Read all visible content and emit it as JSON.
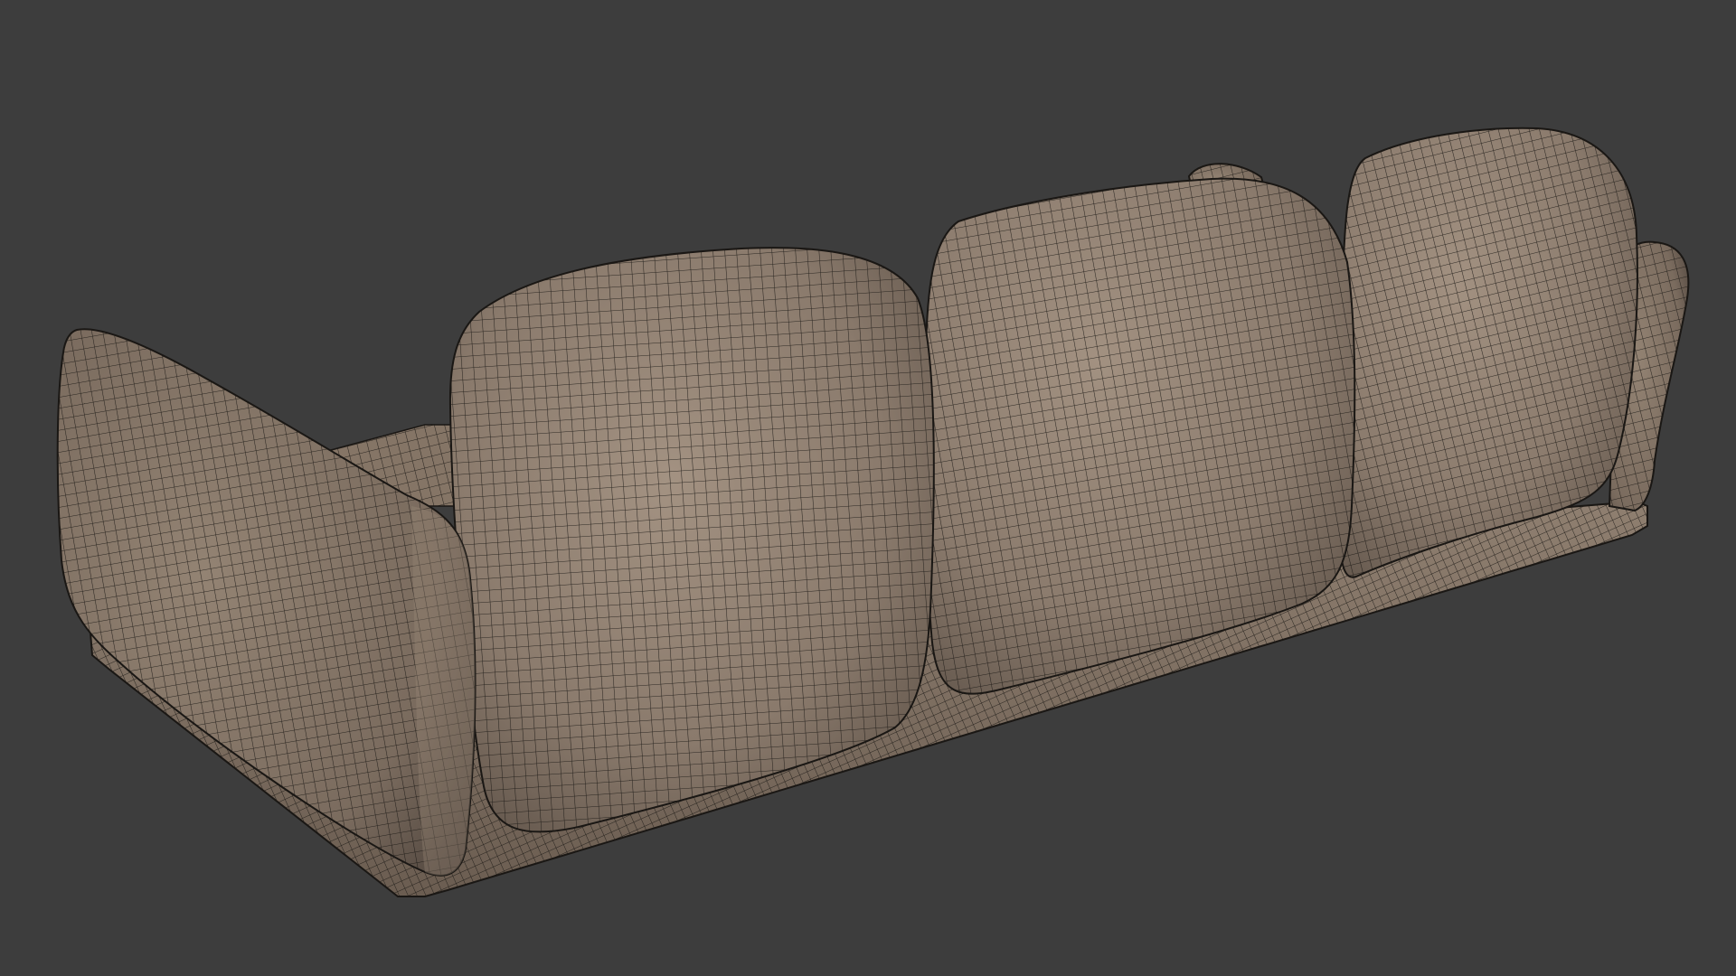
{
  "scene": {
    "background_color": "#3d3d3d",
    "object": "sofa",
    "view": "wireframe-on-shaded",
    "surface_color": "#8c7b6d",
    "wire_color": "#1a1714",
    "parts": [
      {
        "name": "left-armrest-cushion"
      },
      {
        "name": "back-cushion-left"
      },
      {
        "name": "back-cushion-middle"
      },
      {
        "name": "back-cushion-right"
      },
      {
        "name": "right-armrest"
      },
      {
        "name": "base-frame"
      }
    ]
  }
}
